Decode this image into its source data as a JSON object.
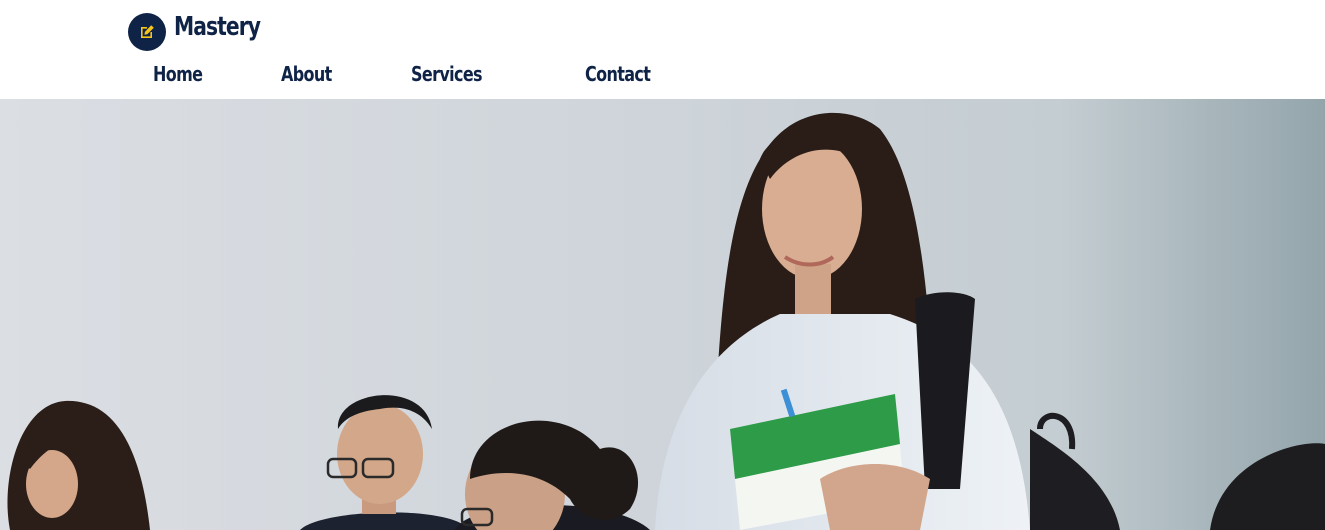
{
  "brand": {
    "name": "Mastery",
    "icon": "edit-icon",
    "icon_bg": "#0f2347",
    "icon_color": "#f5c518"
  },
  "nav": {
    "items": [
      {
        "label": "Home"
      },
      {
        "label": "About"
      },
      {
        "label": "Services"
      },
      {
        "label": "Contact"
      }
    ]
  },
  "hero": {
    "image": "students-classroom-photo"
  },
  "colors": {
    "primary": "#0f2347",
    "accent": "#f5c518"
  }
}
